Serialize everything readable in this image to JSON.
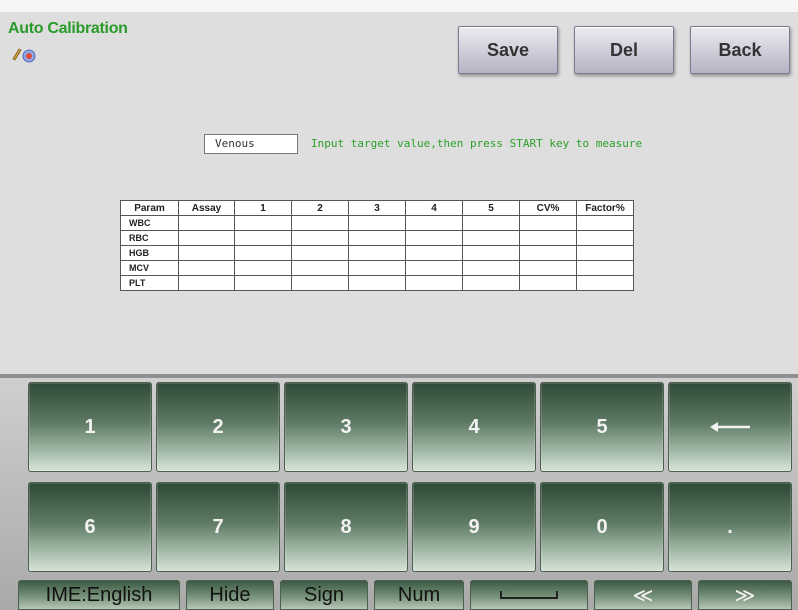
{
  "header": {
    "title": "Auto Calibration",
    "buttons": {
      "save": "Save",
      "del": "Del",
      "back": "Back"
    }
  },
  "calibration": {
    "mode_value": "Venous",
    "hint": "Input target value,then press START key to measure"
  },
  "table": {
    "columns": [
      "Param",
      "Assay",
      "1",
      "2",
      "3",
      "4",
      "5",
      "CV%",
      "Factor%"
    ],
    "rows": [
      "WBC",
      "RBC",
      "HGB",
      "MCV",
      "PLT"
    ]
  },
  "keypad": {
    "row1": [
      "1",
      "2",
      "3",
      "4",
      "5",
      "←"
    ],
    "row2": [
      "6",
      "7",
      "8",
      "9",
      "0",
      "."
    ]
  },
  "function_bar": {
    "ime": "IME:English",
    "hide": "Hide",
    "sign": "Sign",
    "num": "Num",
    "prev": "≪",
    "next": "≫"
  },
  "colors": {
    "title": "#2a9a2a",
    "hint": "#2ba02b",
    "key_dark": "#2e4a36"
  }
}
